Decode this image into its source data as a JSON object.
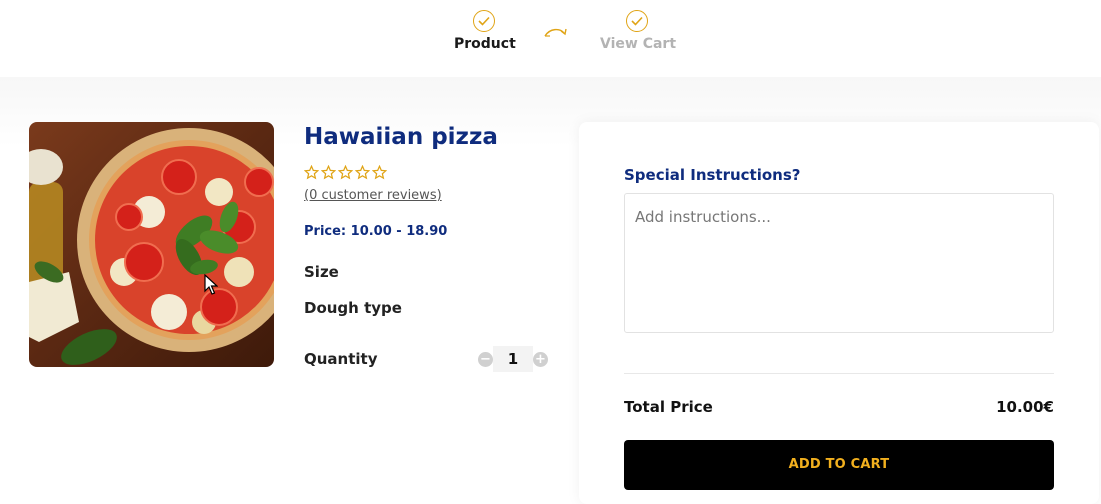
{
  "stepper": {
    "steps": [
      {
        "label": "Product",
        "state": "active",
        "icon": "check-circle-icon"
      },
      {
        "label": "View Cart",
        "state": "inactive",
        "icon": "check-circle-icon"
      }
    ],
    "connector_icon": "curved-arrow-icon"
  },
  "product": {
    "image_icon": "pizza-photo",
    "title": "Hawaiian pizza",
    "rating": 0,
    "max_rating": 5,
    "reviews_text": "(0 customer reviews)",
    "price_text": "Price: 10.00 - 18.90",
    "options": {
      "size_label": "Size",
      "dough_label": "Dough type",
      "quantity_label": "Quantity"
    },
    "quantity": {
      "value": "1",
      "minus_symbol": "−",
      "plus_symbol": "+"
    }
  },
  "order": {
    "special_instructions_label": "Special Instructions?",
    "special_instructions_placeholder": "Add instructions...",
    "special_instructions_value": "",
    "total_label": "Total Price",
    "total_value": "10.00€",
    "add_to_cart_label": "ADD TO CART"
  },
  "colors": {
    "accent_gold": "#e0a416",
    "brand_navy": "#0f2c7e",
    "button_bg": "#000000",
    "button_text": "#f2b01e"
  }
}
